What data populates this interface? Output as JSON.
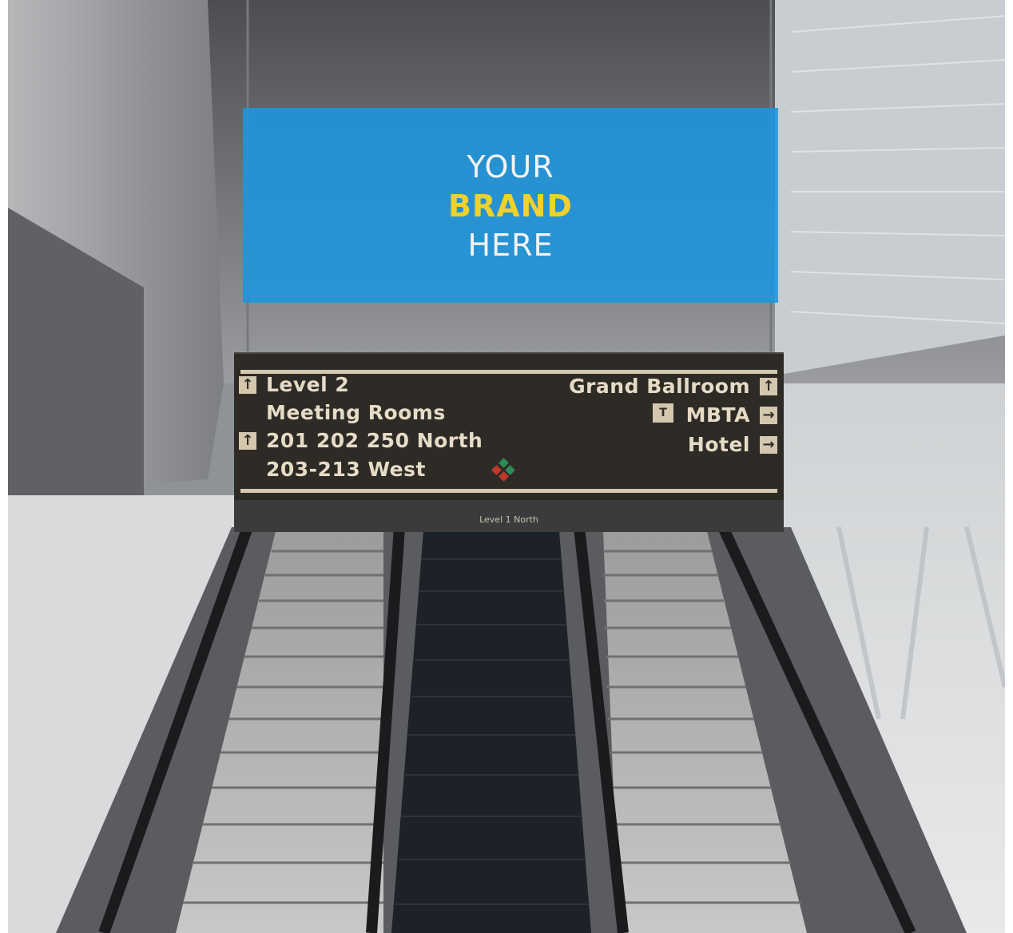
{
  "ad": {
    "line1": "YOUR",
    "line2": "BRAND",
    "line3": "HERE"
  },
  "sign": {
    "left": [
      {
        "text": "Level 2",
        "arrow": "↑"
      },
      {
        "text": "Meeting Rooms",
        "arrow": ""
      },
      {
        "text": "201 202 250 North",
        "arrow": "↑"
      },
      {
        "text": "203-213 West",
        "arrow": ""
      }
    ],
    "right": [
      {
        "text": "Grand Ballroom",
        "arrow": "↑"
      },
      {
        "text": "MBTA",
        "arrow": "→",
        "badge": "T"
      },
      {
        "text": "Hotel",
        "arrow": "→"
      }
    ],
    "sub_label": "Level 1 North"
  },
  "colors": {
    "banner": "#1c96de",
    "brand_accent": "#f2d12a",
    "sign_bg": "#2e2b27",
    "sign_text": "#e6dcc6"
  }
}
